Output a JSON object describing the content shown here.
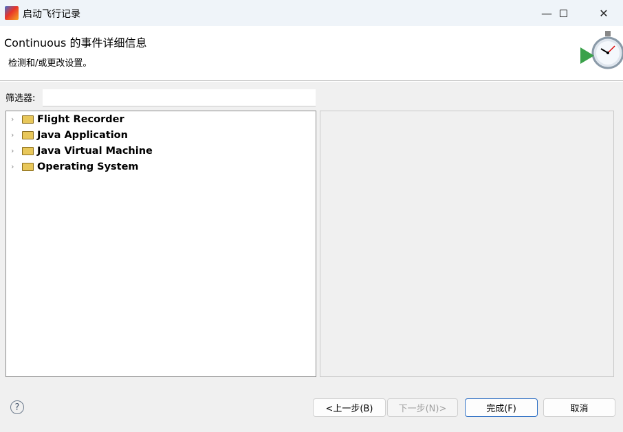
{
  "window": {
    "title": "启动飞行记录",
    "minimize_icon": "minimize-icon",
    "maximize_icon": "maximize-icon",
    "close_icon": "close-icon"
  },
  "header": {
    "title": "Continuous 的事件详细信息",
    "description": "检测和/或更改设置。",
    "banner_icon": "stopwatch-play-icon"
  },
  "filter": {
    "label": "筛选器:",
    "value": "",
    "placeholder": ""
  },
  "tree": {
    "items": [
      {
        "label": "Flight Recorder",
        "icon": "folder-icon",
        "expanded": false
      },
      {
        "label": "Java Application",
        "icon": "folder-icon",
        "expanded": false
      },
      {
        "label": "Java Virtual Machine",
        "icon": "folder-icon",
        "expanded": false
      },
      {
        "label": "Operating System",
        "icon": "folder-icon",
        "expanded": false
      }
    ]
  },
  "footer": {
    "help_icon": "help-icon",
    "back": "<上一步(B)",
    "next": "下一步(N)>",
    "finish": "完成(F)",
    "cancel": "取消"
  }
}
